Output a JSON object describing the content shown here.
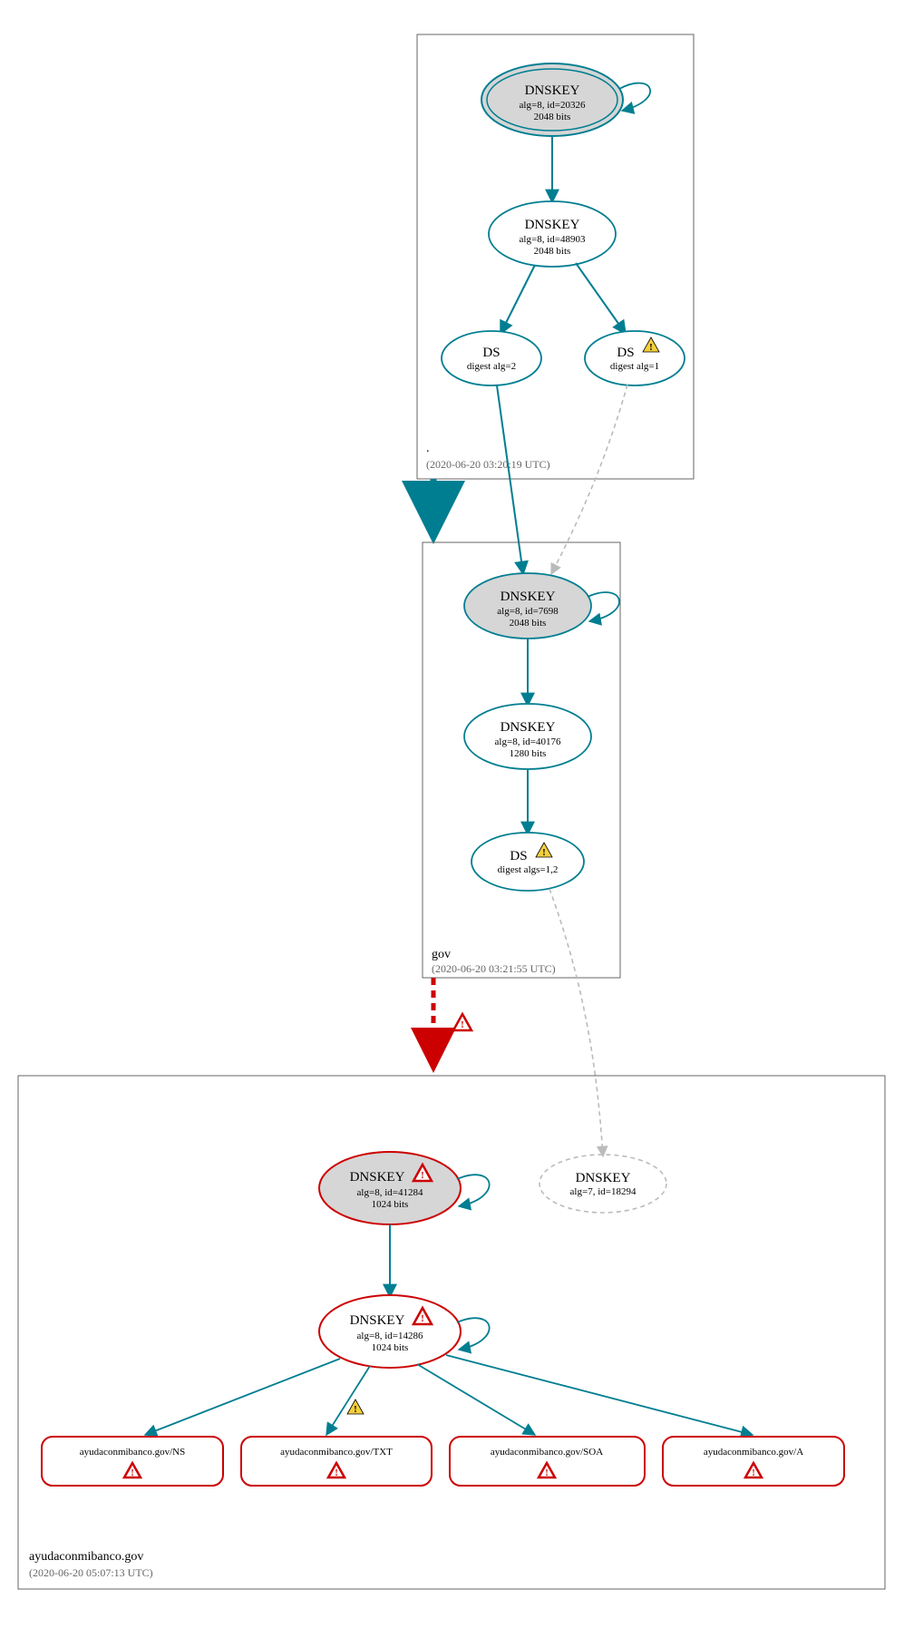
{
  "zones": {
    "root": {
      "label": ".",
      "timestamp": "(2020-06-20 03:20:19 UTC)"
    },
    "gov": {
      "label": "gov",
      "timestamp": "(2020-06-20 03:21:55 UTC)"
    },
    "leaf": {
      "label": "ayudaconmibanco.gov",
      "timestamp": "(2020-06-20 05:07:13 UTC)"
    }
  },
  "nodes": {
    "root_ksk": {
      "title": "DNSKEY",
      "line2": "alg=8, id=20326",
      "line3": "2048 bits"
    },
    "root_zsk": {
      "title": "DNSKEY",
      "line2": "alg=8, id=48903",
      "line3": "2048 bits"
    },
    "root_ds2": {
      "title": "DS",
      "line2": "digest alg=2"
    },
    "root_ds1": {
      "title": "DS",
      "line2": "digest alg=1"
    },
    "gov_ksk": {
      "title": "DNSKEY",
      "line2": "alg=8, id=7698",
      "line3": "2048 bits"
    },
    "gov_zsk": {
      "title": "DNSKEY",
      "line2": "alg=8, id=40176",
      "line3": "1280 bits"
    },
    "gov_ds": {
      "title": "DS",
      "line2": "digest algs=1,2"
    },
    "leaf_ksk": {
      "title": "DNSKEY",
      "line2": "alg=8, id=41284",
      "line3": "1024 bits"
    },
    "leaf_zsk": {
      "title": "DNSKEY",
      "line2": "alg=8, id=14286",
      "line3": "1024 bits"
    },
    "leaf_ghost": {
      "title": "DNSKEY",
      "line2": "alg=7, id=18294"
    }
  },
  "records": {
    "ns": "ayudaconmibanco.gov/NS",
    "txt": "ayudaconmibanco.gov/TXT",
    "soa": "ayudaconmibanco.gov/SOA",
    "a": "ayudaconmibanco.gov/A"
  },
  "colors": {
    "teal": "#007e91",
    "red": "#c00000",
    "greyFill": "#d6d6d6",
    "ghost": "#bbbbbb"
  }
}
